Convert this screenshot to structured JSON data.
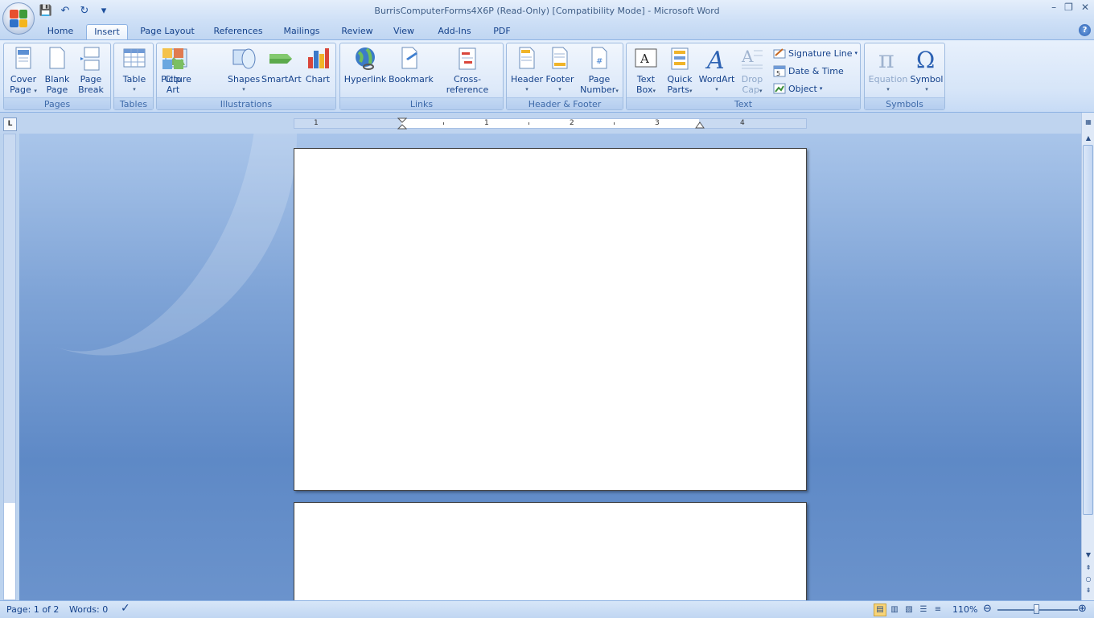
{
  "window": {
    "title": "BurrisComputerForms4X6P (Read-Only) [Compatibility Mode] - Microsoft Word",
    "controls": [
      "–",
      "❐",
      "✕"
    ]
  },
  "qat": {
    "icons": [
      "save-icon",
      "undo-icon",
      "redo-icon",
      "customize-icon"
    ],
    "glyphs": [
      "💾",
      "↶",
      "↻",
      "▾"
    ]
  },
  "tabs": [
    {
      "label": "Home"
    },
    {
      "label": "Insert",
      "active": true
    },
    {
      "label": "Page Layout"
    },
    {
      "label": "References"
    },
    {
      "label": "Mailings"
    },
    {
      "label": "Review"
    },
    {
      "label": "View"
    },
    {
      "label": "Add-Ins"
    },
    {
      "label": "PDF"
    }
  ],
  "help": "?",
  "ribbon": {
    "groups": {
      "pages": "Pages",
      "tables": "Tables",
      "illustrations": "Illustrations",
      "links": "Links",
      "header_footer": "Header & Footer",
      "text": "Text",
      "symbols": "Symbols"
    },
    "buttons": {
      "cover_page_1": "Cover",
      "cover_page_2": "Page",
      "blank_page_1": "Blank",
      "blank_page_2": "Page",
      "page_break_1": "Page",
      "page_break_2": "Break",
      "table": "Table",
      "picture": "Picture",
      "clip_art_1": "Clip",
      "clip_art_2": "Art",
      "shapes": "Shapes",
      "smartart": "SmartArt",
      "chart": "Chart",
      "hyperlink": "Hyperlink",
      "bookmark": "Bookmark",
      "cross_reference": "Cross-reference",
      "header": "Header",
      "footer": "Footer",
      "page_number_1": "Page",
      "page_number_2": "Number",
      "text_box_1": "Text",
      "text_box_2": "Box",
      "quick_parts_1": "Quick",
      "quick_parts_2": "Parts",
      "wordart": "WordArt",
      "drop_cap_1": "Drop",
      "drop_cap_2": "Cap",
      "signature_line": "Signature Line",
      "date_time": "Date & Time",
      "object": "Object",
      "equation": "Equation",
      "symbol": "Symbol",
      "arrow": "▾"
    }
  },
  "ruler": {
    "tab_selector": "L",
    "numbers": [
      "1",
      "1",
      "2",
      "3",
      "4"
    ]
  },
  "status": {
    "page": "Page: 1 of 2",
    "words": "Words: 0",
    "zoom": "110%",
    "zoom_out": "⊖",
    "zoom_in": "⊕"
  },
  "colors": {
    "accent": "#15428b",
    "ribbon": "#dde9f9",
    "document_bg": "#6b93cc"
  }
}
